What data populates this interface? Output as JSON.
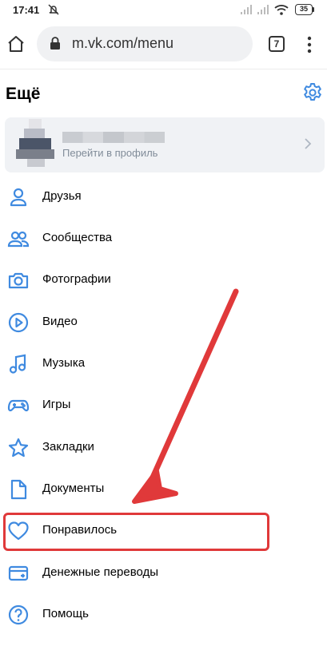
{
  "status_bar": {
    "time": "17:41",
    "battery": "35"
  },
  "browser": {
    "url": "m.vk.com/menu",
    "tab_count": "7"
  },
  "page": {
    "title": "Ещё"
  },
  "profile": {
    "subtitle": "Перейти в профиль"
  },
  "menu": {
    "items": [
      {
        "label": "Друзья",
        "icon": "friend-icon"
      },
      {
        "label": "Сообщества",
        "icon": "communities-icon"
      },
      {
        "label": "Фотографии",
        "icon": "camera-icon"
      },
      {
        "label": "Видео",
        "icon": "video-play-icon"
      },
      {
        "label": "Музыка",
        "icon": "music-note-icon"
      },
      {
        "label": "Игры",
        "icon": "gamepad-icon"
      },
      {
        "label": "Закладки",
        "icon": "star-icon"
      },
      {
        "label": "Документы",
        "icon": "document-icon"
      },
      {
        "label": "Понравилось",
        "icon": "heart-icon"
      },
      {
        "label": "Денежные переводы",
        "icon": "money-card-icon"
      },
      {
        "label": "Помощь",
        "icon": "help-icon"
      }
    ]
  },
  "colors": {
    "accent": "#3f8ae0",
    "annotation_red": "#e0393a"
  }
}
